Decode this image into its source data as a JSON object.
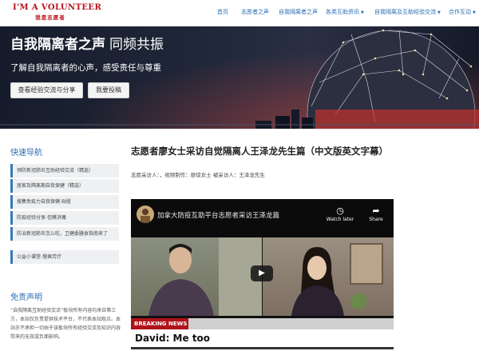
{
  "brand": {
    "name_en": "I'M A VOLUNTEER",
    "name_cn": "我是志愿者"
  },
  "nav": [
    {
      "label": "首页",
      "dropdown": false
    },
    {
      "label": "志愿者之声",
      "dropdown": false
    },
    {
      "label": "自我隔离者之声",
      "dropdown": false
    },
    {
      "label": "各类互助资讯",
      "dropdown": true
    },
    {
      "label": "自我隔离及互助经验交流",
      "dropdown": true
    },
    {
      "label": "合作互动",
      "dropdown": true
    }
  ],
  "hero": {
    "title": "自我隔离者之声",
    "subtitle": "同频共振",
    "description": "了解自我隔离者的心声，感受责任与尊重",
    "buttons": [
      "查看经验交流与分享",
      "我要投稿"
    ]
  },
  "sidebar": {
    "quick_nav_title": "快速导航",
    "items": [
      "预防新冠肺炎互助经验交流（精选）",
      "居家及隔离期自我保健（精选）",
      "搜集免疫力自我保健-贴赃",
      "防疫经验分享-信瞧消毒",
      "防治新冠肺炎怎么吃，卫健委膳食指南来了",
      "公益小课堂-慢摊芳疗"
    ],
    "disclaimer_title": "免责声明",
    "disclaimer_text": "“自我隔离互助经验交流”板块所有内容均来自第三方，本站仅负责提供技术平台，不代表本站观点。本站亦不承担一切由于该板块所有经验交流及知识内容带来的无效或负面影响。"
  },
  "article": {
    "title": "志愿者廖女士采访自觉隔离人王泽龙先生篇（中文版英文字幕）",
    "meta": "志愿采访人：，视频制作：廖琼女士    被采访人：王泽龙先生"
  },
  "video": {
    "title": "加拿大防疫互助平台志愿者采访王泽龙篇",
    "watch_later": "Watch later",
    "share": "Share",
    "breaking": "BREAKING NEWS",
    "caption": "David: Me too"
  },
  "colors": {
    "brand_red": "#b8121b",
    "link_blue": "#2a6fb3",
    "breaking_red": "#b0121a"
  }
}
